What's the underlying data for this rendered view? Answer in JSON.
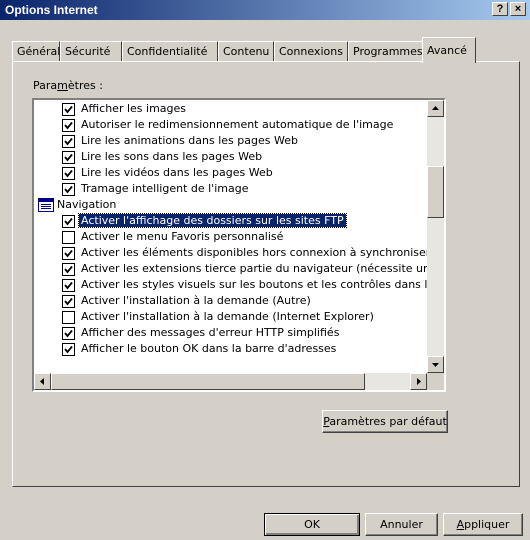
{
  "window": {
    "title": "Options Internet",
    "help_label": "?",
    "close_label": "×"
  },
  "tabs": [
    "Général",
    "Sécurité",
    "Confidentialité",
    "Contenu",
    "Connexions",
    "Programmes",
    "Avancé"
  ],
  "active_tab": "Avancé",
  "settings": {
    "label_prefix": "Para",
    "label_mnemonic": "m",
    "label_suffix": "ètres :",
    "items": [
      {
        "label": "Afficher les images",
        "checked": true
      },
      {
        "label": "Autoriser le redimensionnement automatique de l'image",
        "checked": true
      },
      {
        "label": "Lire les animations dans les pages Web",
        "checked": true
      },
      {
        "label": "Lire les sons dans les pages Web",
        "checked": true
      },
      {
        "label": "Lire les vidéos dans les pages Web",
        "checked": true
      },
      {
        "label": "Tramage intelligent de l'image",
        "checked": true
      },
      {
        "label": "Navigation",
        "category": true,
        "icon": "category-folder-icon"
      },
      {
        "label": "Activer l'affichage des dossiers sur les sites FTP",
        "checked": true,
        "selected": true
      },
      {
        "label": "Activer le menu Favoris personnalisé",
        "checked": false
      },
      {
        "label": "Activer les éléments disponibles hors connexion à synchroniser lors c",
        "checked": true
      },
      {
        "label": "Activer les extensions tierce partie du navigateur (nécessite un redér",
        "checked": true
      },
      {
        "label": "Activer les styles visuels sur les boutons et les contrôles dans les pag",
        "checked": true
      },
      {
        "label": "Activer l'installation à la demande (Autre)",
        "checked": true
      },
      {
        "label": "Activer l'installation à la demande (Internet Explorer)",
        "checked": false
      },
      {
        "label": "Afficher des messages d'erreur HTTP simplifiés",
        "checked": true
      },
      {
        "label": "Afficher le bouton OK dans la barre d'adresses",
        "checked": true
      }
    ]
  },
  "buttons": {
    "defaults_mnemonic": "P",
    "defaults_rest": "aramètres par défaut",
    "ok": "OK",
    "cancel": "Annuler",
    "apply_mnemonic": "A",
    "apply_rest": "ppliquer"
  }
}
